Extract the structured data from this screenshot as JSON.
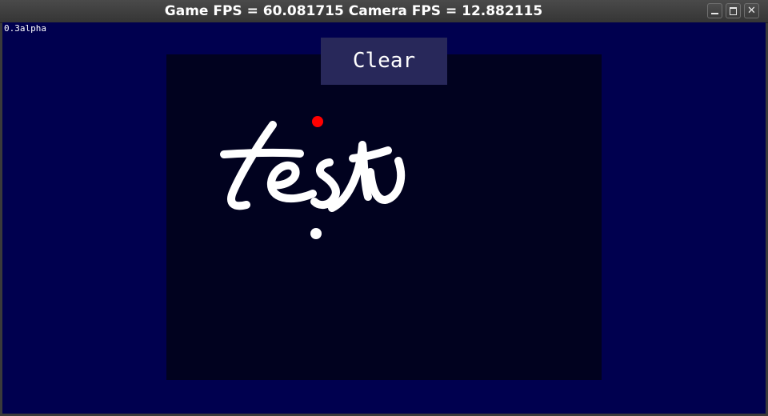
{
  "window": {
    "title": "Game FPS = 60.081715 Camera FPS = 12.882115",
    "minimize_icon": "minimize-icon",
    "maximize_icon": "maximize-icon",
    "close_icon": "close-icon",
    "close_glyph": "✕"
  },
  "game": {
    "version": "0.3alpha",
    "clear_label": "Clear",
    "handwriting_color": "#ffffff",
    "pointer_color": "#ff0000",
    "canvas_color": "#01021f",
    "background_color": "#00004f"
  }
}
